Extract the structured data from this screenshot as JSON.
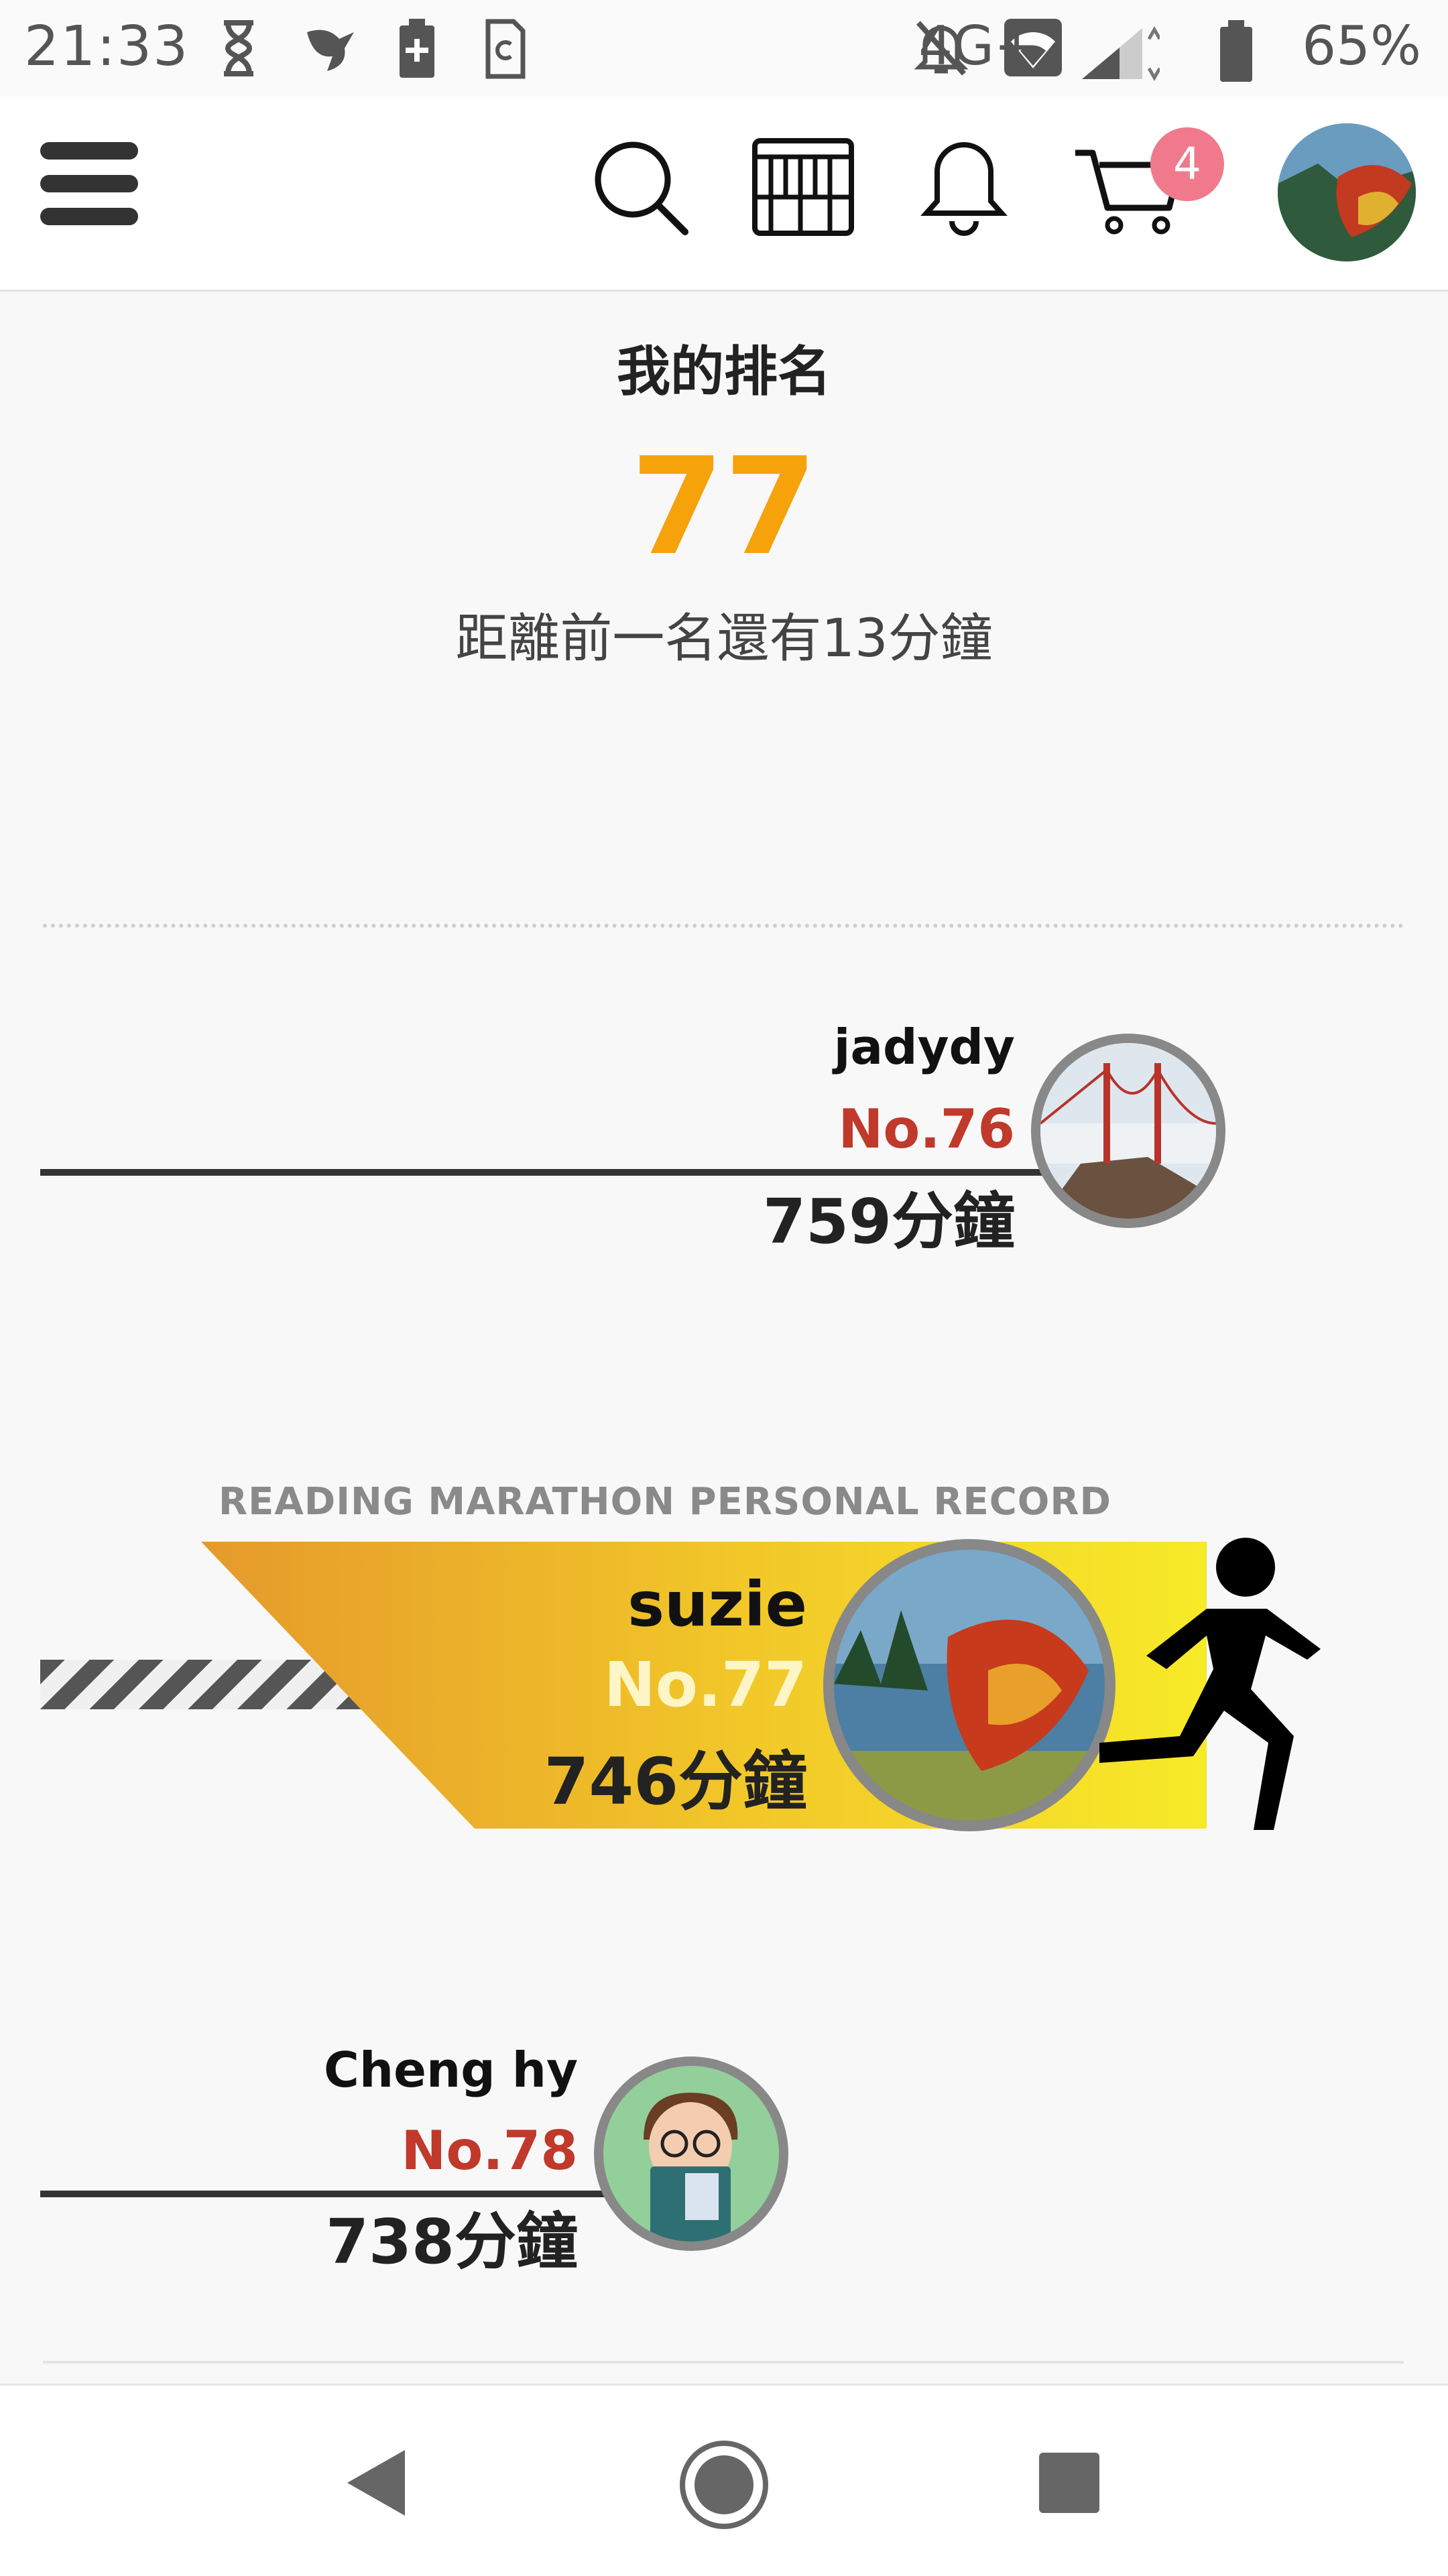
{
  "status_bar": {
    "time": "21:33",
    "network": "4G+",
    "battery": "65%"
  },
  "header": {
    "cart_count": "4"
  },
  "ranking": {
    "label": "我的排名",
    "rank": "77",
    "gap_text": "距離前一名還有13分鐘"
  },
  "personal_record_label": "READING MARATHON PERSONAL RECORD",
  "competitors": [
    {
      "name": "jadydy",
      "rank": "No.76",
      "minutes": "759分鐘"
    },
    {
      "name": "suzie",
      "rank": "No.77",
      "minutes": "746分鐘"
    },
    {
      "name": "Cheng hy",
      "rank": "No.78",
      "minutes": "738分鐘"
    }
  ],
  "colors": {
    "rank_orange": "#f5a20b",
    "rank_red": "#c0392b",
    "badge_pink": "#f07a8c"
  },
  "icons": [
    "hourglass-icon",
    "bird-icon",
    "battery-plus-icon",
    "sim-icon",
    "bell-off-icon",
    "wifi-icon",
    "signal-icon",
    "battery-icon",
    "menu-icon",
    "search-icon",
    "bookshelf-icon",
    "bell-icon",
    "cart-icon",
    "runner-icon",
    "back-icon",
    "home-icon",
    "recents-icon"
  ]
}
